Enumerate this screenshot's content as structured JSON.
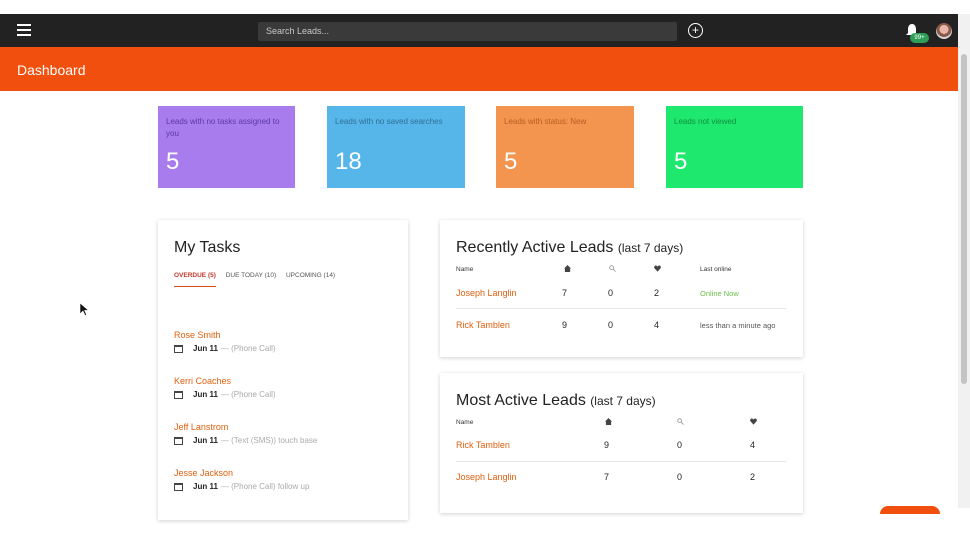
{
  "topbar": {
    "search_placeholder": "Search Leads...",
    "notification_badge": "99+"
  },
  "page": {
    "title": "Dashboard"
  },
  "stats": [
    {
      "label": "Leads with no tasks assigned to you",
      "value": "5",
      "color": "#a87cec"
    },
    {
      "label": "Leads with no saved searches",
      "value": "18",
      "color": "#56b6ea"
    },
    {
      "label": "Leads with status: New",
      "value": "5",
      "color": "#f3954e"
    },
    {
      "label": "Leads not viewed",
      "value": "5",
      "color": "#1ee86e"
    }
  ],
  "tasks": {
    "title": "My Tasks",
    "tabs": [
      "OVERDUE (5)",
      "DUE TODAY (10)",
      "UPCOMING (14)"
    ],
    "items": [
      {
        "name": "Rose Smith",
        "date": "Jun 11",
        "detail": " — (Phone Call)"
      },
      {
        "name": "Kerri Coaches",
        "date": "Jun 11",
        "detail": " — (Phone Call)"
      },
      {
        "name": "Jeff Lanstrom",
        "date": "Jun 11",
        "detail": " — (Text (SMS)) touch base"
      },
      {
        "name": "Jesse Jackson",
        "date": "Jun 11",
        "detail": " — (Phone Call) follow up"
      }
    ]
  },
  "recent": {
    "title": "Recently Active Leads",
    "title_suffix": "(last 7 days)",
    "col_name": "Name",
    "col_last_online": "Last online",
    "rows": [
      {
        "name": "Joseph Langlin",
        "views": "7",
        "searches": "0",
        "favorites": "2",
        "last_online": "Online Now"
      },
      {
        "name": "Rick Tamblen",
        "views": "9",
        "searches": "0",
        "favorites": "4",
        "last_online": "less than a minute ago"
      }
    ]
  },
  "most": {
    "title": "Most Active Leads",
    "title_suffix": "(last 7 days)",
    "col_name": "Name",
    "rows": [
      {
        "name": "Rick Tamblen",
        "views": "9",
        "searches": "0",
        "favorites": "4"
      },
      {
        "name": "Joseph Langlin",
        "views": "7",
        "searches": "0",
        "favorites": "2"
      }
    ]
  },
  "icons": {
    "menu": "hamburger-icon",
    "add": "plus-circle-icon",
    "bell": "bell-icon",
    "views": "home-icon",
    "searches": "search-icon",
    "favorites": "heart-icon",
    "calendar": "calendar-icon"
  },
  "colors": {
    "accent": "#f04f0d",
    "link": "#e0600f",
    "online": "#6cc04a"
  }
}
